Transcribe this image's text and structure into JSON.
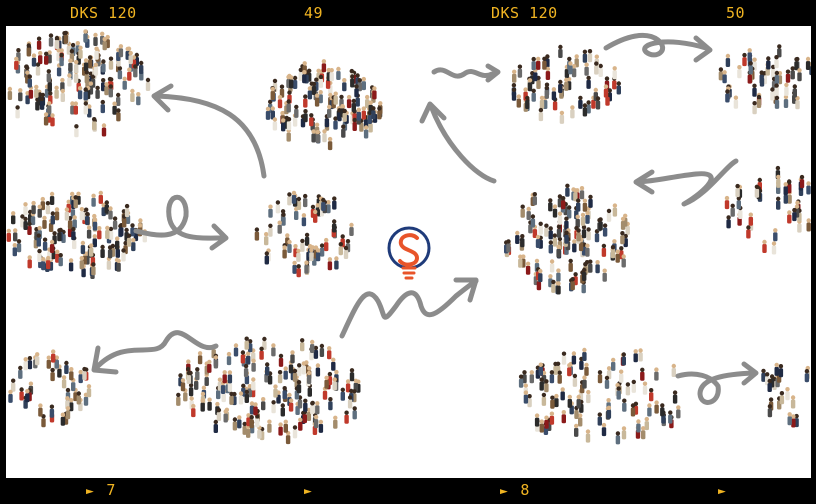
{
  "film_strip": {
    "top_labels": [
      "DKS 120",
      "49",
      "DKS 120",
      "50"
    ],
    "bottom_labels": [
      {
        "arrow": "►",
        "number": "7"
      },
      {
        "arrow": "►",
        "number": ""
      },
      {
        "arrow": "►",
        "number": "8"
      },
      {
        "arrow": "►",
        "number": ""
      }
    ],
    "accent_color": "#f0b422"
  },
  "image": {
    "subject": "crowds of people walking on white background with hand-drawn arrows",
    "logo": "lightbulb-s-logo",
    "logo_colors": [
      "#1f3b7a",
      "#e8542a"
    ],
    "arrow_color": "#8c8c8c"
  }
}
